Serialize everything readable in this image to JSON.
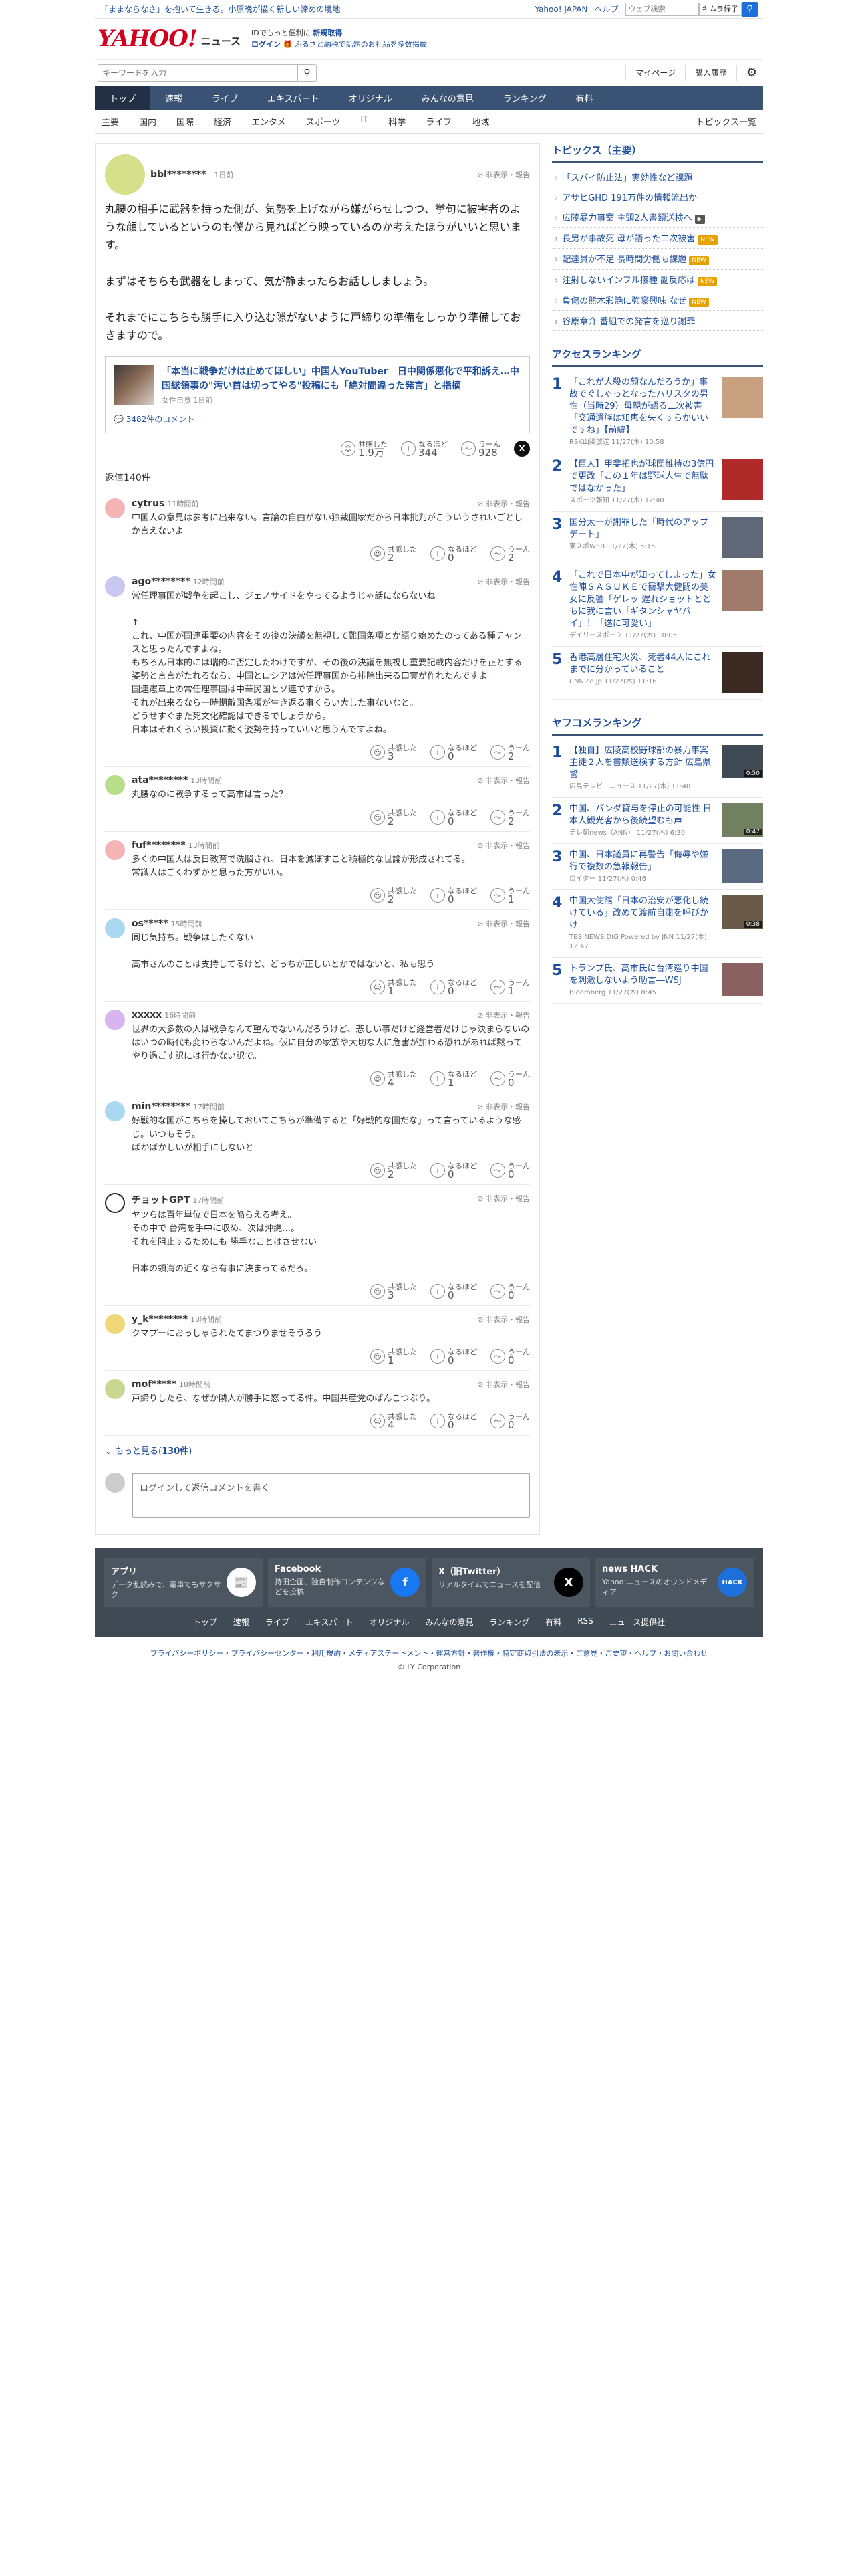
{
  "topbar": {
    "promo": "「ままならなさ」を抱いて生きる。小原晩が描く新しい諦めの境地",
    "links": [
      "Yahoo! JAPAN",
      "ヘルプ"
    ],
    "search_placeholder": "ウェブ検索",
    "kimura": "キムラ緑子"
  },
  "brand": {
    "logo_top": "YAHOO!",
    "logo_bottom": "JAPAN",
    "news": "ニュース",
    "tag1a": "ID",
    "tag1b": "でもっと便利に",
    "tag1c": "新規取得",
    "tag2a": "ログイン",
    "tag2b": "ふるさと納税で話題のお礼品を多数掲載"
  },
  "search": {
    "placeholder": "キーワードを入力"
  },
  "account": {
    "mypage": "マイページ",
    "history": "購入履歴"
  },
  "mainnav": [
    "トップ",
    "速報",
    "ライブ",
    "エキスパート",
    "オリジナル",
    "みんなの意見",
    "ランキング",
    "有料"
  ],
  "subnav": {
    "items": [
      "主要",
      "国内",
      "国際",
      "経済",
      "エンタメ",
      "スポーツ",
      "IT",
      "科学",
      "ライフ",
      "地域"
    ],
    "right": "トピックス一覧"
  },
  "post": {
    "user": "bbl********",
    "time": "1日前",
    "hide": "非表示・報告",
    "text": "丸腰の相手に武器を持った側が、気勢を上げながら嫌がらせしつつ、挙句に被害者のような顔しているというのも僕から見ればどう映っているのか考えたほうがいいと思います。\n\nまずはそちらも武器をしまって、気が静まったらお話ししましょう。\n\nそれまでにこちらも勝手に入り込む隙がないように戸締りの準備をしっかり準備しておきますので。",
    "article_title": "「本当に戦争だけは止めてほしい」中国人YouTuber　日中関係悪化で平和訴え…中国総領事の\"汚い首は切ってやる\"投稿にも「絶対間違った発言」と指摘",
    "article_source": "女性自身 1日前",
    "article_comments": "3482件のコメント",
    "reacts": [
      {
        "label": "共感した",
        "num": "1.9万"
      },
      {
        "label": "なるほど",
        "num": "344"
      },
      {
        "label": "うーん",
        "num": "928"
      }
    ],
    "x": "X"
  },
  "reply_count": "返信140件",
  "replies": [
    {
      "user": "cytrus",
      "time": "11時間前",
      "color": "#f5b4b4",
      "text": "中国人の意見は参考に出来ない。言論の自由がない独裁国家だから日本批判がこういうされいごとしか言えないよ",
      "r": [
        "2",
        "0",
        "2"
      ]
    },
    {
      "user": "ago********",
      "time": "12時間前",
      "color": "#c8c8f0",
      "text": "常任理事国が戦争を起こし、ジェノサイドをやってるようじゃ話にならないね。\n\n↑\nこれ、中国が国連重要の内容をその後の決議を無視して難国条項とか語り始めたのってある種チャンスと思ったんですよね。\nもちろん日本的には瑞的に否定したわけですが、その後の決議を無視し重要記載内容だけを正とする姿勢と言言がたれるなら、中国とロシアは常任理事国から排除出来る口実が作れたんですよ。\n国連憲章上の常任理事国は中華民国とソ連ですから。\nそれが出来るなら一時期敵国条項が生き返る事くらい大した事ないなと。\nどうせすぐまた死文化確認はできるでしょうから。\n日本はそれくらい投資に動く姿勢を持っていいと思うんですよね。",
      "r": [
        "3",
        "0",
        "2"
      ]
    },
    {
      "user": "ata********",
      "time": "13時間前",
      "color": "#b9de8a",
      "text": "丸腰なのに戦争するって高市は言った？",
      "r": [
        "2",
        "0",
        "2"
      ]
    },
    {
      "user": "fuf********",
      "time": "13時間前",
      "color": "#f5b4b4",
      "text": "多くの中国人は反日教育で洗脳され、日本を滅ぼすこと積極的な世論が形成されてる。\n常識人はごくわずかと思った方がいい。",
      "r": [
        "2",
        "0",
        "1"
      ]
    },
    {
      "user": "os*****",
      "time": "15時間前",
      "color": "#a9d8f0",
      "text": "同じ気持ち。戦争はしたくない\n\n高市さんのことは支持してるけど、どっちが正しいとかではないと、私も思う",
      "r": [
        "1",
        "0",
        "1"
      ]
    },
    {
      "user": "xxxxx",
      "time": "16時間前",
      "color": "#d8b4f0",
      "text": "世界の大多数の人は戦争なんて望んでないんだろうけど、悲しい事だけど経営者だけじゃ決まらないのはいつの時代も変わらないんだよね。仮に自分の家族や大切な人に危害が加わる恐れがあれば黙ってやり過ごす訳には行かない訳で。",
      "r": [
        "4",
        "1",
        "0"
      ]
    },
    {
      "user": "min********",
      "time": "17時間前",
      "color": "#a9d8f0",
      "text": "好戦的な国がこちらを操しておいてこちらが準備すると「好戦的な国だな」って言っているような感じ。いつもそう。\nばかばかしいが相手にしないと",
      "r": [
        "2",
        "0",
        "0"
      ]
    },
    {
      "user": "チョットGPT",
      "time": "17時間前",
      "color": "#ffffff",
      "text": "ヤツらは百年単位で日本を陥らえる考え。\nその中で 台湾を手中に収め、次は沖縄…。\nそれを阻止するためにも 勝手なことはさせない\n\n日本の領海の近くなら有事に決まってるだろ。",
      "r": [
        "3",
        "0",
        "0"
      ]
    },
    {
      "user": "y_k********",
      "time": "18時間前",
      "color": "#f0d878",
      "text": "クマプーにおっしゃられたてまつりませそうろう",
      "r": [
        "1",
        "0",
        "0"
      ]
    },
    {
      "user": "mof*****",
      "time": "18時間前",
      "color": "#c8d890",
      "text": "戸締りしたら、なぜか隣人が勝手に怒ってる件。中国共産党のぱんこつぶり。",
      "r": [
        "4",
        "0",
        "0"
      ]
    }
  ],
  "react_labels": [
    "共感した",
    "なるほど",
    "うーん"
  ],
  "more": {
    "pre": "もっと見る(",
    "num": "130件",
    "post": ")"
  },
  "comment_box": "ログインして返信コメントを書く",
  "topics": {
    "title": "トピックス（主要）",
    "items": [
      {
        "t": "「スパイ防止法」実効性など課題",
        "b": ""
      },
      {
        "t": "アサヒGHD 191万件の情報流出か",
        "b": ""
      },
      {
        "t": "広陵暴力事案 主頭2人書類送検へ",
        "b": "▶"
      },
      {
        "t": "長男が事故死 母が語った二次被害",
        "b": "NEW"
      },
      {
        "t": "配達員が不足 長時間労働も課題",
        "b": "NEW"
      },
      {
        "t": "注射しないインフル接種 副反応は",
        "b": "NEW"
      },
      {
        "t": "負傷の熊木彩艶に強豪興味 なぜ",
        "b": "NEW"
      },
      {
        "t": "谷原章介 番組での発言を巡り謝罪",
        "b": ""
      }
    ]
  },
  "access": {
    "title": "アクセスランキング",
    "items": [
      {
        "t": "「これが人殺の顔なんだろうか」事故でぐしゃっとなったハリスタの男性（当時29）母親が語る二次被害「交通遺族は知恵を失くすらかいいですね」【前編】",
        "s": "RSK山陽放送 11/27(木) 10:58",
        "c": "#c9a080"
      },
      {
        "t": "【巨人】甲斐拓也が球団維持の3億円で更改「この１年は野球人生で無駄ではなかった」",
        "s": "スポーツ報知 11/27(木) 12:40",
        "c": "#b02a2a"
      },
      {
        "t": "国分太一が謝罪した「時代のアップデート」",
        "s": "東スポWEB 11/27(木) 5:15",
        "c": "#606878"
      },
      {
        "t": "「これで日本中が知ってしまった」女性陣ＳＡＳＵＫＥで衝撃大健闘の美女に反響「ゲレッ 遅れショットとともに我に言い「ギタンシャヤバイ」！「遂に可愛い」",
        "s": "デイリースポーツ 11/27(木) 10:05",
        "c": "#a07a6a"
      },
      {
        "t": "香港高層住宅火災、死者44人にこれまでに分かっていること",
        "s": "CNN.co.jp 11/27(木) 11:16",
        "c": "#3a2a22"
      }
    ]
  },
  "yahoo_rank": {
    "title": "ヤフコメランキング",
    "items": [
      {
        "t": "【独自】広陵高校野球部の暴力事案 主徒２人を書類送検する方針 広島県警",
        "s": "広島テレビ　ニュース 11/27(木) 11:40",
        "d": "0:50",
        "c": "#404a55"
      },
      {
        "t": "中国、パンダ貸与を停止の可能性 日本人観光客から後続望むも声",
        "s": "テレ朝news（ANN） 11/27(木) 6:30",
        "d": "0:47",
        "c": "#708060"
      },
      {
        "t": "中国、日本議員に再警告「侮辱や嫌行で複数の急報報告」",
        "s": "ロイター 11/27(木) 0:46",
        "d": "",
        "c": "#5a6a80"
      },
      {
        "t": "中国大使館「日本の治安が悪化し続けている」改めて渡航自粛を呼びかけ",
        "s": "TBS NEWS DIG Powered by JNN 11/27(木) 12:47",
        "d": "0:38",
        "c": "#6a5a48"
      },
      {
        "t": "トランプ氏、高市氏に台湾巡り中国を刺激しないよう助言―WSJ",
        "s": "Bloomberg 11/27(木) 8:45",
        "d": "",
        "c": "#8a6060"
      }
    ]
  },
  "footer": {
    "cells": [
      {
        "t": "アプリ",
        "d": "データ乱読みで、電車でもサクサク",
        "icon": "📰",
        "bg": "#ffffff",
        "fg": "#d1001e"
      },
      {
        "t": "Facebook",
        "d": "持田企画、独自制作コンテンツなどを投稿",
        "icon": "f",
        "bg": "#1877f2",
        "fg": "#ffffff"
      },
      {
        "t": "X（旧Twitter）",
        "d": "リアルタイムでニュースを配信",
        "icon": "X",
        "bg": "#000000",
        "fg": "#ffffff"
      },
      {
        "t": "news HACK",
        "d": "Yahoo!ニュースのオウンドメディア",
        "icon": "HACK",
        "bg": "#1d6fd9",
        "fg": "#ffffff"
      }
    ],
    "links": [
      "トップ",
      "速報",
      "ライブ",
      "エキスパート",
      "オリジナル",
      "みんなの意見",
      "ランキング",
      "有料",
      "RSS",
      "ニュース提供社"
    ]
  },
  "legal": "プライバシーポリシー・プライバシーセンター・利用規約・メディアステートメント・運営方針・著作権・特定商取引法の表示・ご意見・ご要望・ヘルプ・お問い合わせ",
  "copyright": "© LY Corporation"
}
